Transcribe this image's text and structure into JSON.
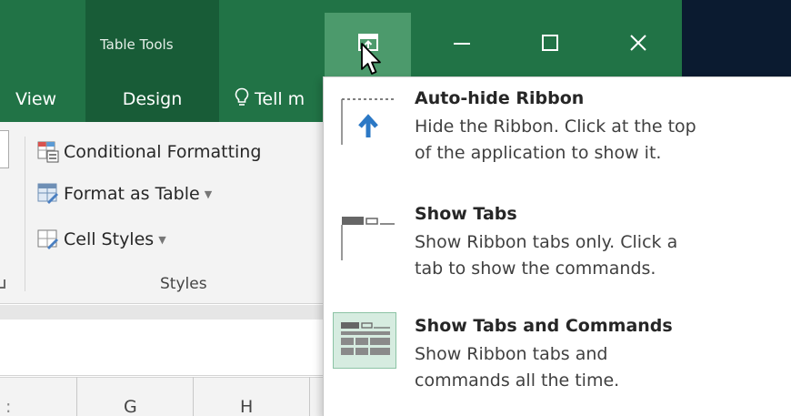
{
  "title_bar": {
    "contextual_group": "Table Tools",
    "controls": [
      "ribbon-display-options-icon",
      "minimize-icon",
      "restore-icon",
      "close-icon"
    ]
  },
  "tabs": {
    "view": "View",
    "design": "Design",
    "tell_me": "Tell m"
  },
  "ribbon": {
    "styles_group": {
      "conditional_formatting": "Conditional Formatting",
      "format_as_table": "Format as Table",
      "cell_styles": "Cell Styles",
      "label": "Styles"
    }
  },
  "sheet": {
    "columns": [
      "G",
      "H"
    ]
  },
  "menu": {
    "items": [
      {
        "icon": "auto-hide-ribbon-icon",
        "title": "Auto-hide Ribbon",
        "desc_line1": "Hide the Ribbon. Click at the top",
        "desc_line2": "of the application to show it."
      },
      {
        "icon": "show-tabs-icon",
        "title": "Show Tabs",
        "desc_line1": "Show Ribbon tabs only. Click a",
        "desc_line2": "tab to show the commands."
      },
      {
        "icon": "show-tabs-and-commands-icon",
        "title": "Show Tabs and Commands",
        "desc_line1": "Show Ribbon tabs and",
        "desc_line2": "commands all the time.",
        "selected": true
      }
    ]
  },
  "colors": {
    "title_green": "#217346",
    "dark_green": "#185c37",
    "hover_green": "#4c9a6c",
    "arrow_blue": "#2b78c5"
  }
}
